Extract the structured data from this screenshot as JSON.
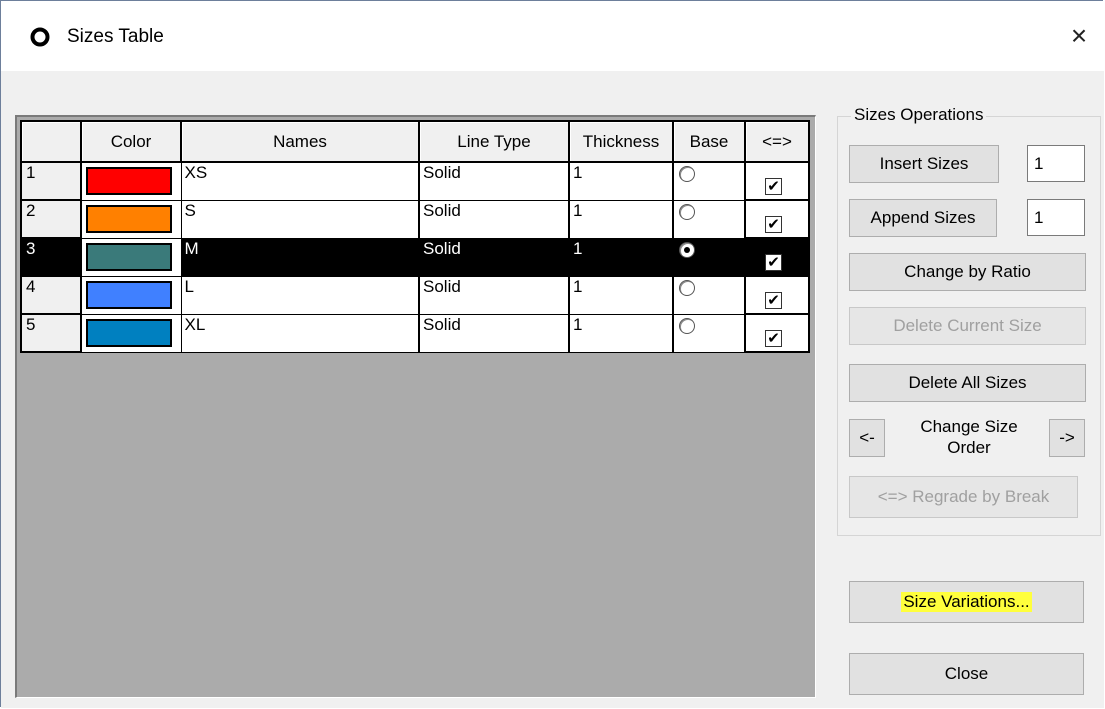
{
  "window": {
    "title": "Sizes Table",
    "close_glyph": "×"
  },
  "grid": {
    "columns": [
      "",
      "Color",
      "Names",
      "Line Type",
      "Thickness",
      "Base",
      "<=>"
    ],
    "rows": [
      {
        "num": "1",
        "color": "#ff0000",
        "name": "XS",
        "line_type": "Solid",
        "thickness": "1",
        "base": false,
        "checked": true
      },
      {
        "num": "2",
        "color": "#ff8000",
        "name": "S",
        "line_type": "Solid",
        "thickness": "1",
        "base": false,
        "checked": true
      },
      {
        "num": "3",
        "color": "#3a7a7a",
        "name": "M",
        "line_type": "Solid",
        "thickness": "1",
        "base": true,
        "checked": true
      },
      {
        "num": "4",
        "color": "#4080ff",
        "name": "L",
        "line_type": "Solid",
        "thickness": "1",
        "base": false,
        "checked": true
      },
      {
        "num": "5",
        "color": "#0080c0",
        "name": "XL",
        "line_type": "Solid",
        "thickness": "1",
        "base": false,
        "checked": true
      }
    ],
    "selected_row": 3
  },
  "ops": {
    "group_label": "Sizes Operations",
    "insert_label": "Insert Sizes",
    "insert_count": "1",
    "append_label": "Append Sizes",
    "append_count": "1",
    "change_ratio_label": "Change by Ratio",
    "delete_current_label": "Delete Current Size",
    "delete_all_label": "Delete All Sizes",
    "order_left": "<-",
    "order_label_1": "Change Size",
    "order_label_2": "Order",
    "order_right": "->",
    "regrade_label": "<=> Regrade by Break"
  },
  "footer": {
    "size_variations_label": "Size Variations...",
    "close_label": "Close"
  },
  "colors": {
    "highlight": "#ffff3c",
    "selected_row_bg": "#000000"
  }
}
